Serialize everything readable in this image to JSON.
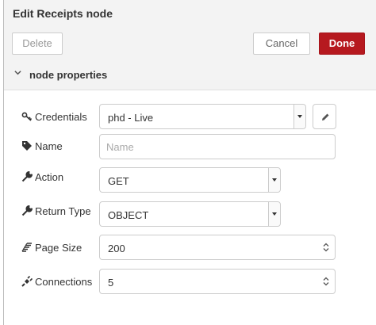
{
  "header": {
    "title": "Edit Receipts node"
  },
  "toolbar": {
    "delete_label": "Delete",
    "cancel_label": "Cancel",
    "done_label": "Done"
  },
  "section": {
    "title": "node properties",
    "icon": "chevron-down-icon"
  },
  "fields": {
    "credentials": {
      "label": "Credentials",
      "value": "phd - Live",
      "icon": "key-icon"
    },
    "name": {
      "label": "Name",
      "placeholder": "Name",
      "value": "",
      "icon": "tag-icon"
    },
    "action": {
      "label": "Action",
      "value": "GET",
      "icon": "wrench-icon"
    },
    "return_type": {
      "label": "Return Type",
      "value": "OBJECT",
      "icon": "wrench-icon"
    },
    "page_size": {
      "label": "Page Size",
      "value": "200",
      "icon": "layers-icon"
    },
    "connections": {
      "label": "Connections",
      "value": "5",
      "icon": "plug-icon"
    }
  },
  "colors": {
    "done_button": "#b6191f",
    "panel_bg": "#f3f3f3"
  }
}
